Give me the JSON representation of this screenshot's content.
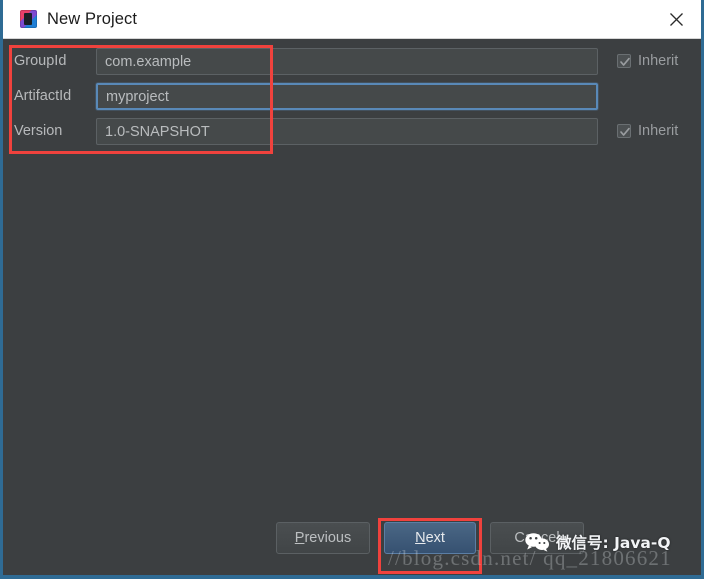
{
  "window": {
    "title": "New Project",
    "app_icon": "intellij-idea-icon",
    "close_icon": "close-icon"
  },
  "form": {
    "rows": [
      {
        "label": "GroupId",
        "value": "com.example",
        "placeholder": "",
        "focused": false,
        "inherit_label": "Inherit",
        "inherit_checked": true,
        "has_inherit": true
      },
      {
        "label": "ArtifactId",
        "value": "myproject",
        "placeholder": "",
        "focused": true,
        "inherit_label": "",
        "inherit_checked": false,
        "has_inherit": false
      },
      {
        "label": "Version",
        "value": "1.0-SNAPSHOT",
        "placeholder": "",
        "focused": false,
        "inherit_label": "Inherit",
        "inherit_checked": true,
        "has_inherit": true
      }
    ]
  },
  "footer": {
    "previous_label": "Previous",
    "previous_mnemonic": "P",
    "previous_rest": "revious",
    "next_label": "Next",
    "next_mnemonic": "N",
    "next_rest": "ext",
    "cancel_label": "Cancel"
  },
  "annotations": [
    {
      "name": "fields-highlight",
      "color": "#f0423d"
    },
    {
      "name": "next-button-highlight",
      "color": "#f0423d"
    }
  ],
  "watermarks": {
    "url": "//blog.csdn.net/ qq_21806621",
    "wechat_text": "微信号: Java-Q",
    "wechat_icon": "wechat-icon"
  },
  "colors": {
    "window_background": "#3c3f41",
    "titlebar_background": "#ffffff",
    "window_border": "#2f6b94",
    "field_background": "#45494a",
    "field_border": "#5c6164",
    "focus_border": "#5989b8",
    "default_button": "#4a6785",
    "annotation_red": "#f0423d",
    "label_text": "#b7b9bb"
  }
}
